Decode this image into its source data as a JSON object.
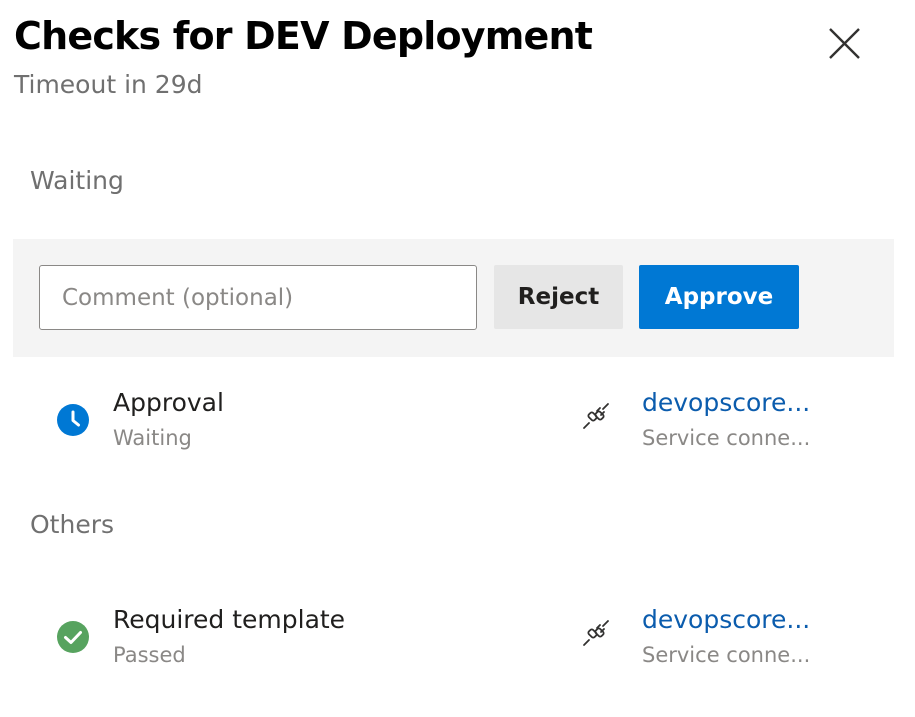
{
  "header": {
    "title": "Checks for DEV Deployment",
    "subtitle": "Timeout in 29d",
    "close_icon": "close-icon"
  },
  "waiting_section": {
    "label": "Waiting",
    "comment_placeholder": "Comment (optional)",
    "comment_value": "",
    "reject_label": "Reject",
    "approve_label": "Approve",
    "accent_color": "#0078d4"
  },
  "checks_waiting": [
    {
      "name": "Approval",
      "status": "Waiting",
      "status_icon": "clock-icon",
      "status_color": "#0078d4",
      "resource_icon": "plug-icon",
      "resource_name": "devopscore...",
      "resource_type": "Service conne..."
    }
  ],
  "others_section": {
    "label": "Others"
  },
  "checks_others": [
    {
      "name": "Required template",
      "status": "Passed",
      "status_icon": "checkmark-circle-icon",
      "status_color": "#57a35f",
      "resource_icon": "plug-icon",
      "resource_name": "devopscore...",
      "resource_type": "Service conne..."
    }
  ]
}
